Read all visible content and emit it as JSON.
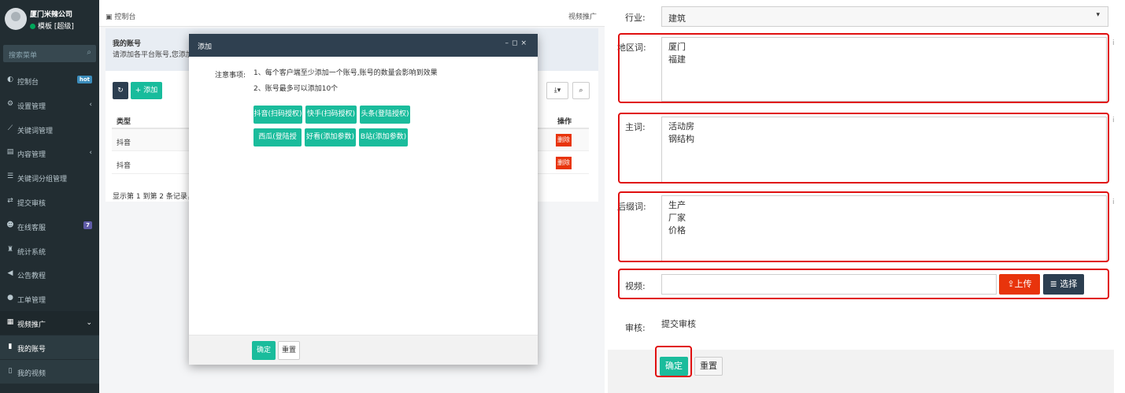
{
  "sidebar": {
    "company": "厦门米辣公司",
    "status": "模板 [超级]",
    "search_placeholder": "搜索菜单",
    "items": [
      {
        "icon": "dashboard-icon",
        "label": "控制台",
        "badge": "hot",
        "badge_color": "#3c8dbc"
      },
      {
        "icon": "gears-icon",
        "label": "设置管理",
        "arrow": "‹"
      },
      {
        "icon": "line-chart-icon",
        "label": "关键词管理"
      },
      {
        "icon": "content-icon",
        "label": "内容管理",
        "arrow": "‹"
      },
      {
        "icon": "list-icon",
        "label": "关键词分组管理"
      },
      {
        "icon": "exchange-icon",
        "label": "提交审核"
      },
      {
        "icon": "users-icon",
        "label": "在线客服",
        "badge": "7",
        "badge_color": "#605ca8"
      },
      {
        "icon": "stats-icon",
        "label": "统计系统"
      },
      {
        "icon": "bullhorn-icon",
        "label": "公告教程"
      },
      {
        "icon": "comment-icon",
        "label": "工单管理"
      },
      {
        "icon": "film-icon",
        "label": "视频推广",
        "arrow": "⌄"
      },
      {
        "icon": "file-icon",
        "label": "我的账号"
      },
      {
        "icon": "file-outline-icon",
        "label": "我的视频"
      }
    ]
  },
  "topbar": {
    "breadcrumb": "控制台",
    "right_tab": "视频推广"
  },
  "panel": {
    "title": "我的账号",
    "desc": "请添加各平台账号,您添加的账号",
    "add_label": "添加",
    "col_type": "类型",
    "col_action": "操作",
    "rows": [
      {
        "type": "抖音",
        "action": "删除"
      },
      {
        "type": "抖音",
        "action": "删除"
      }
    ],
    "footer": "显示第 1 到第 2 条记录，总共 2 条记录"
  },
  "modal": {
    "title": "添加",
    "notice_label": "注意事项:",
    "lines": [
      "1、每个客户端至少添加一个账号,账号的数量会影响到效果",
      "2、账号最多可以添加10个"
    ],
    "buttons_row1": [
      "抖音(扫码授权)",
      "快手(扫码授权)",
      "头条(登陆授权)"
    ],
    "buttons_row2": [
      "西瓜(登陆授权)",
      "好看(添加参数)",
      "B站(添加参数)"
    ],
    "confirm": "确定",
    "reset": "重置"
  },
  "form": {
    "industry_label": "行业:",
    "industry_value": "建筑",
    "region_label": "地区词:",
    "region_lines": [
      "厦门",
      "福建"
    ],
    "main_label": "主词:",
    "main_lines": [
      "活动房",
      "钢结构"
    ],
    "suffix_label": "后缀词:",
    "suffix_lines": [
      "生产",
      "厂家",
      "价格"
    ],
    "video_label": "视频:",
    "upload_label": "上传",
    "choose_label": "选择",
    "review_label": "审核:",
    "review_value": "提交审核",
    "confirm": "确定",
    "reset": "重置"
  },
  "colors": {
    "accent": "#1abc9c",
    "danger": "#e8340c",
    "highlight": "#e01010",
    "sidebar": "#222d32"
  }
}
